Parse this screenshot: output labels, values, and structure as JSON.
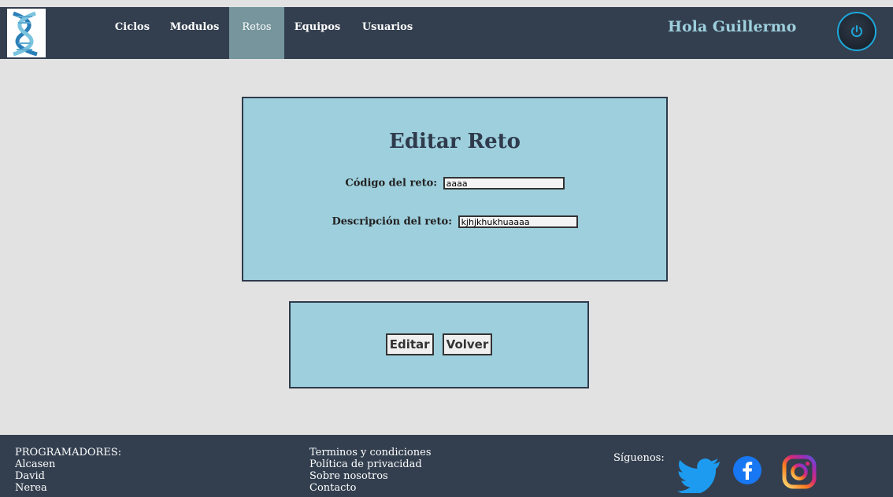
{
  "nav": {
    "items": [
      {
        "label": "Ciclos"
      },
      {
        "label": "Modulos"
      },
      {
        "label": "Retos"
      },
      {
        "label": "Equipos"
      },
      {
        "label": "Usuarios"
      }
    ],
    "active_index": 2,
    "greeting": "Hola Guillermo",
    "power_icon": "power-icon",
    "logo_icon": "dna-logo-icon"
  },
  "form": {
    "title": "Editar Reto",
    "code_label": "Código del reto:",
    "code_value": "aaaa",
    "description_label": "Descripción del reto:",
    "description_value": "kjhjkhukhuaaaa"
  },
  "actions": {
    "edit_label": "Editar",
    "back_label": "Volver"
  },
  "footer": {
    "programmers_heading": "PROGRAMADORES:",
    "programmers": [
      "Alcasen",
      "David",
      "Nerea"
    ],
    "links": [
      "Terminos y condiciones",
      "Política de privacidad",
      "Sobre nosotros",
      "Contacto"
    ],
    "follow_label": "Síguenos:",
    "social_icons": [
      "twitter-icon",
      "facebook-icon",
      "instagram-icon"
    ]
  },
  "colors": {
    "header_bg": "#333f4f",
    "active_tab": "#76959c",
    "panel_bg": "#9ecfdd",
    "page_bg": "#e2e2e2",
    "power_ring": "#1da8dc"
  }
}
